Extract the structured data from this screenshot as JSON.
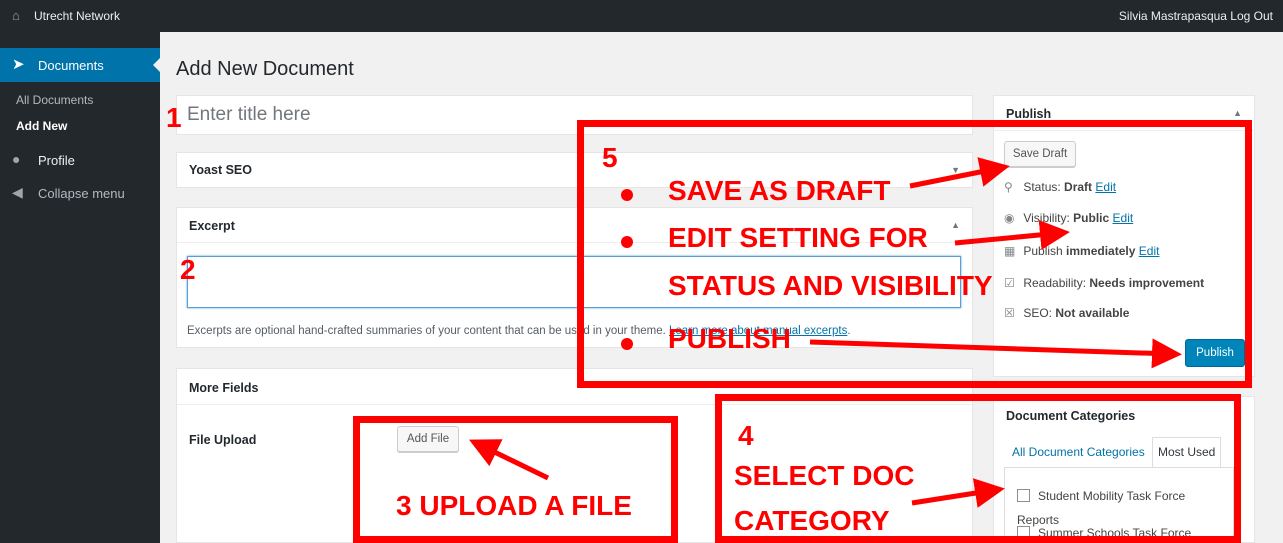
{
  "topbar": {
    "site_name": "Utrecht Network",
    "user_text": "Silvia Mastrapasqua Log Out"
  },
  "sidebar": {
    "current": "Documents",
    "submenu": [
      "All Documents",
      "Add New"
    ],
    "profile": "Profile",
    "collapse": "Collapse menu"
  },
  "page": {
    "title": "Add New Document"
  },
  "title_field": {
    "placeholder": "Enter title here"
  },
  "yoast": {
    "title": "Yoast SEO"
  },
  "excerpt": {
    "title": "Excerpt",
    "help_text": "Excerpts are optional hand-crafted summaries of your content that can be used in your theme.",
    "help_link": "Learn more about manual excerpts",
    "help_end": "."
  },
  "more_fields": {
    "title": "More Fields",
    "file_label": "File Upload",
    "add_file": "Add File"
  },
  "publish": {
    "title": "Publish",
    "save_draft": "Save Draft",
    "status_label": "Status:",
    "status_value": "Draft",
    "visibility_label": "Visibility:",
    "visibility_value": "Public",
    "publish_label": "Publish",
    "publish_value": "immediately",
    "edit": "Edit",
    "readability_label": "Readability:",
    "readability_value": "Needs improvement",
    "seo_label": "SEO:",
    "seo_value": "Not available",
    "publish_button": "Publish"
  },
  "categories": {
    "title": "Document Categories",
    "tab_all": "All Document Categories",
    "tab_most": "Most Used",
    "items": [
      "Student Mobility Task Force Reports",
      "Summer Schools Task Force"
    ]
  },
  "annotations": {
    "n1": "1",
    "n2": "2",
    "n3": "3 UPLOAD A FILE",
    "n4": "4",
    "n4_line1": "SELECT DOC",
    "n4_line2": "CATEGORY",
    "n5": "5",
    "b1": "SAVE AS DRAFT",
    "b2a": "EDIT SETTING FOR",
    "b2b": "STATUS AND VISIBILITY",
    "b3": "PUBLISH",
    "color": "#ff0000"
  },
  "colors": {
    "admin_bar": "#23282d",
    "accent": "#0073aa",
    "primary_button": "#0085ba"
  }
}
